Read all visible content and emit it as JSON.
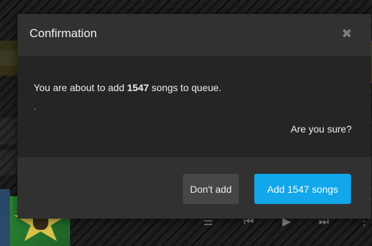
{
  "modal": {
    "title": "Confirmation",
    "close_icon": "close-icon",
    "message_prefix": "You are about to add ",
    "song_count": "1547",
    "message_suffix": " songs to queue.",
    "question": "Are you sure?",
    "cancel_label": "Don't add",
    "confirm_label": "Add 1547 songs"
  },
  "player": {
    "controls": {
      "queue_icon": "queue-icon",
      "previous_icon": "skip-previous-icon",
      "play_icon": "play-icon",
      "next_icon": "skip-next-icon",
      "more_icon": "more-icon"
    }
  },
  "colors": {
    "accent": "#12a6ea",
    "modal_header": "#313131",
    "modal_body": "#252525"
  }
}
